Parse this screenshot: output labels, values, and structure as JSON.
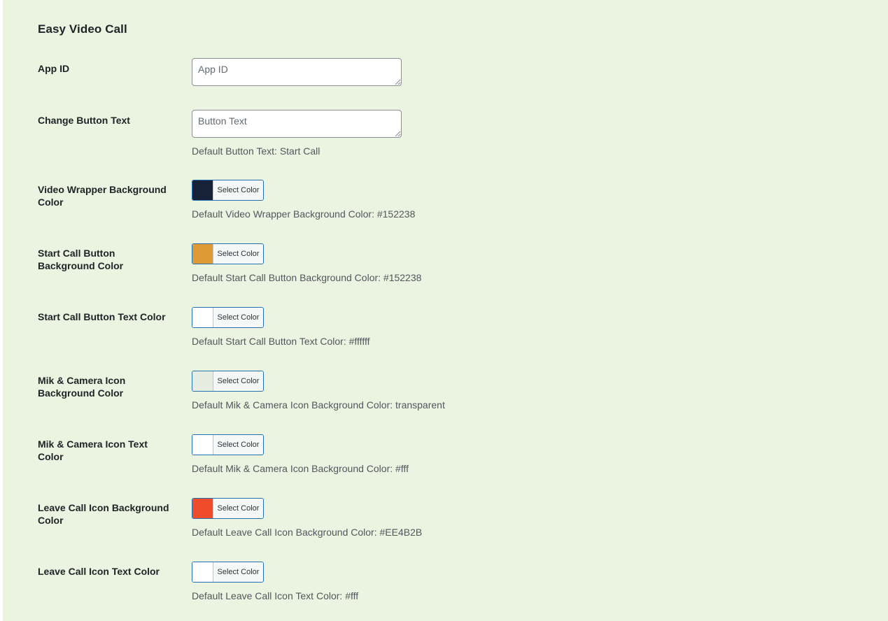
{
  "section": {
    "title": "Easy Video Call"
  },
  "fields": {
    "app_id": {
      "label": "App ID",
      "placeholder": "App ID",
      "value": ""
    },
    "button_text": {
      "label": "Change Button Text",
      "placeholder": "Button Text",
      "value": "",
      "description": "Default Button Text: Start Call"
    },
    "color_pickers": [
      {
        "label": "Video Wrapper Background Color",
        "button_label": "Select Color",
        "swatch_color": "#152238",
        "description": "Default Video Wrapper Background Color: #152238"
      },
      {
        "label": "Start Call Button Background Color",
        "button_label": "Select Color",
        "swatch_color": "#e09a35",
        "description": "Default Start Call Button Background Color: #152238"
      },
      {
        "label": "Start Call Button Text Color",
        "button_label": "Select Color",
        "swatch_color": "#ffffff",
        "description": "Default Start Call Button Text Color: #ffffff"
      },
      {
        "label": "Mik & Camera Icon Background Color",
        "button_label": "Select Color",
        "swatch_color": "transparent",
        "description": "Default Mik & Camera Icon Background Color: transparent"
      },
      {
        "label": "Mik & Camera Icon Text Color",
        "button_label": "Select Color",
        "swatch_color": "#ffffff",
        "description": "Default Mik & Camera Icon Background Color: #fff"
      },
      {
        "label": "Leave Call Icon Background Color",
        "button_label": "Select Color",
        "swatch_color": "#EE4B2B",
        "description": "Default Leave Call Icon Background Color: #EE4B2B"
      },
      {
        "label": "Leave Call Icon Text Color",
        "button_label": "Select Color",
        "swatch_color": "#ffffff",
        "description": "Default Leave Call Icon Text Color: #fff"
      }
    ]
  }
}
